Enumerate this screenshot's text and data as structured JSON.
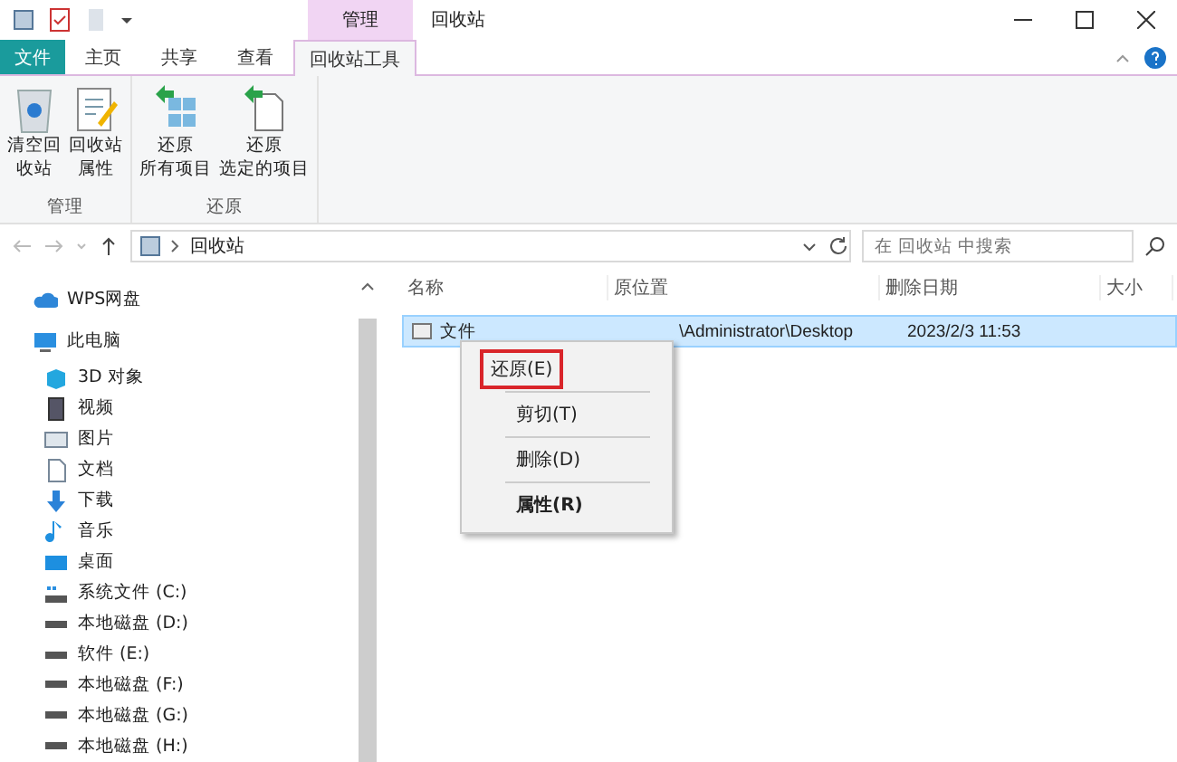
{
  "window": {
    "title": "回收站",
    "context_tab": "管理"
  },
  "ribbon_tabs": [
    {
      "label": "文件",
      "kind": "file",
      "selected": false
    },
    {
      "label": "主页",
      "kind": "tab",
      "selected": false
    },
    {
      "label": "共享",
      "kind": "tab",
      "selected": false
    },
    {
      "label": "查看",
      "kind": "tab",
      "selected": false
    },
    {
      "label": "回收站工具",
      "kind": "tab",
      "selected": true
    }
  ],
  "ribbon_groups": [
    {
      "label": "管理",
      "buttons": [
        {
          "lines": [
            "清空回",
            "收站"
          ],
          "kind": "empty-bin"
        },
        {
          "lines": [
            "回收站",
            "属性"
          ],
          "kind": "properties"
        }
      ]
    },
    {
      "label": "还原",
      "buttons": [
        {
          "lines": [
            "还原",
            "所有项目"
          ],
          "kind": "restore-all"
        },
        {
          "lines": [
            "还原",
            "选定的项目"
          ],
          "kind": "restore-selected"
        }
      ]
    }
  ],
  "address": {
    "path": "回收站",
    "search_placeholder": "在 回收站 中搜索"
  },
  "sidebar": {
    "items": [
      {
        "label": "WPS网盘",
        "kind": "cloud"
      },
      {
        "label": "此电脑",
        "kind": "pc",
        "children": [
          {
            "label": "3D 对象",
            "kind": "cube"
          },
          {
            "label": "视频",
            "kind": "video"
          },
          {
            "label": "图片",
            "kind": "picture"
          },
          {
            "label": "文档",
            "kind": "doc"
          },
          {
            "label": "下载",
            "kind": "download"
          },
          {
            "label": "音乐",
            "kind": "music"
          },
          {
            "label": "桌面",
            "kind": "desktop"
          },
          {
            "label": "系统文件 (C:)",
            "kind": "sysdrive"
          },
          {
            "label": "本地磁盘 (D:)",
            "kind": "drive"
          },
          {
            "label": "软件 (E:)",
            "kind": "drive"
          },
          {
            "label": "本地磁盘 (F:)",
            "kind": "drive"
          },
          {
            "label": "本地磁盘 (G:)",
            "kind": "drive"
          },
          {
            "label": "本地磁盘 (H:)",
            "kind": "drive"
          }
        ]
      }
    ]
  },
  "table": {
    "columns": [
      "名称",
      "原位置",
      "删除日期",
      "大小"
    ],
    "rows": [
      {
        "name": "文件",
        "location": "\\Administrator\\Desktop",
        "date": "2023/2/3 11:53",
        "selected": true
      }
    ]
  },
  "context_menu": {
    "items": [
      {
        "label": "还原(E)",
        "highlighted": true,
        "bold": false
      },
      {
        "label": "剪切(T)",
        "highlighted": false,
        "bold": false
      },
      {
        "label": "删除(D)",
        "highlighted": false,
        "bold": false
      },
      {
        "label": "属性(R)",
        "highlighted": false,
        "bold": true
      }
    ]
  }
}
